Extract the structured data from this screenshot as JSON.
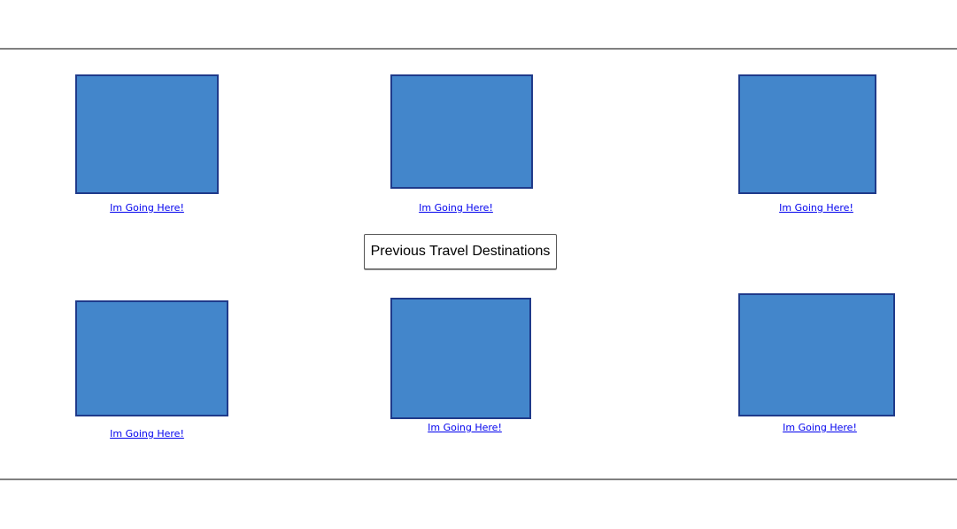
{
  "destinations": [
    {
      "link": "Im Going Here!"
    },
    {
      "link": "Im Going Here!"
    },
    {
      "link": "Im Going Here!"
    },
    {
      "link": "Im Going Here!"
    },
    {
      "link": "Im Going Here!"
    },
    {
      "link": "Im Going Here!"
    }
  ],
  "previous_button": "Previous Travel Destinations",
  "colors": {
    "image_fill": "#4386cb",
    "image_border": "#1f3a8a",
    "link": "#0000ee",
    "rule": "#808080"
  }
}
